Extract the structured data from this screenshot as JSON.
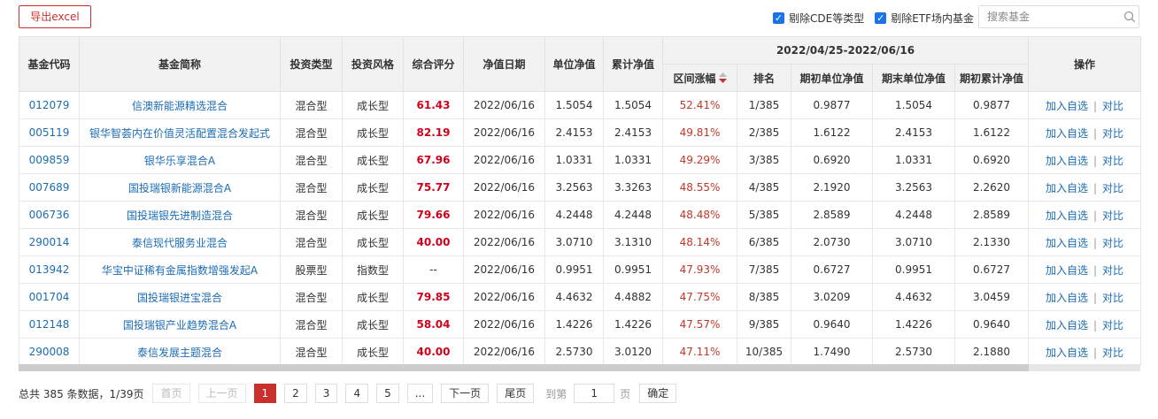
{
  "toolbar": {
    "export_label": "导出excel",
    "filter_cde": "剔除CDE等类型",
    "filter_etf": "剔除ETF场内基金",
    "search_placeholder": "搜索基金"
  },
  "table": {
    "headers": {
      "code": "基金代码",
      "name": "基金简称",
      "type": "投资类型",
      "style": "投资风格",
      "score": "综合评分",
      "nav_date": "净值日期",
      "unit_nav": "单位净值",
      "acc_nav": "累计净值",
      "period": "2022/04/25-2022/06/16",
      "change": "区间涨幅",
      "rank": "排名",
      "start_unit": "期初单位净值",
      "end_unit": "期末单位净值",
      "start_acc": "期初累计净值",
      "ops": "操作"
    },
    "rows": [
      {
        "code": "012079",
        "name": "信澳新能源精选混合",
        "type": "混合型",
        "style": "成长型",
        "score": "61.43",
        "date": "2022/06/16",
        "unit": "1.5054",
        "acc": "1.5054",
        "change": "52.41%",
        "rank": "1/385",
        "s_unit": "0.9877",
        "e_unit": "1.5054",
        "s_acc": "0.9877",
        "add": "加入自选",
        "cmp": "对比"
      },
      {
        "code": "005119",
        "name": "银华智荟内在价值灵活配置混合发起式",
        "type": "混合型",
        "style": "成长型",
        "score": "82.19",
        "date": "2022/06/16",
        "unit": "2.4153",
        "acc": "2.4153",
        "change": "49.81%",
        "rank": "2/385",
        "s_unit": "1.6122",
        "e_unit": "2.4153",
        "s_acc": "1.6122",
        "add": "加入自选",
        "cmp": "对比"
      },
      {
        "code": "009859",
        "name": "银华乐享混合A",
        "type": "混合型",
        "style": "成长型",
        "score": "67.96",
        "date": "2022/06/16",
        "unit": "1.0331",
        "acc": "1.0331",
        "change": "49.29%",
        "rank": "3/385",
        "s_unit": "0.6920",
        "e_unit": "1.0331",
        "s_acc": "0.6920",
        "add": "加入自选",
        "cmp": "对比"
      },
      {
        "code": "007689",
        "name": "国投瑞银新能源混合A",
        "type": "混合型",
        "style": "成长型",
        "score": "75.77",
        "date": "2022/06/16",
        "unit": "3.2563",
        "acc": "3.3263",
        "change": "48.55%",
        "rank": "4/385",
        "s_unit": "2.1920",
        "e_unit": "3.2563",
        "s_acc": "2.2620",
        "add": "加入自选",
        "cmp": "对比"
      },
      {
        "code": "006736",
        "name": "国投瑞银先进制造混合",
        "type": "混合型",
        "style": "成长型",
        "score": "79.66",
        "date": "2022/06/16",
        "unit": "4.2448",
        "acc": "4.2448",
        "change": "48.48%",
        "rank": "5/385",
        "s_unit": "2.8589",
        "e_unit": "4.2448",
        "s_acc": "2.8589",
        "add": "加入自选",
        "cmp": "对比"
      },
      {
        "code": "290014",
        "name": "泰信现代服务业混合",
        "type": "混合型",
        "style": "成长型",
        "score": "40.00",
        "date": "2022/06/16",
        "unit": "3.0710",
        "acc": "3.1310",
        "change": "48.14%",
        "rank": "6/385",
        "s_unit": "2.0730",
        "e_unit": "3.0710",
        "s_acc": "2.1330",
        "add": "加入自选",
        "cmp": "对比"
      },
      {
        "code": "013942",
        "name": "华宝中证稀有金属指数增强发起A",
        "type": "股票型",
        "style": "指数型",
        "score": "--",
        "date": "2022/06/16",
        "unit": "0.9951",
        "acc": "0.9951",
        "change": "47.93%",
        "rank": "7/385",
        "s_unit": "0.6727",
        "e_unit": "0.9951",
        "s_acc": "0.6727",
        "add": "加入自选",
        "cmp": "对比"
      },
      {
        "code": "001704",
        "name": "国投瑞银进宝混合",
        "type": "混合型",
        "style": "成长型",
        "score": "79.85",
        "date": "2022/06/16",
        "unit": "4.4632",
        "acc": "4.4882",
        "change": "47.75%",
        "rank": "8/385",
        "s_unit": "3.0209",
        "e_unit": "4.4632",
        "s_acc": "3.0459",
        "add": "加入自选",
        "cmp": "对比"
      },
      {
        "code": "012148",
        "name": "国投瑞银产业趋势混合A",
        "type": "混合型",
        "style": "成长型",
        "score": "58.04",
        "date": "2022/06/16",
        "unit": "1.4226",
        "acc": "1.4226",
        "change": "47.57%",
        "rank": "9/385",
        "s_unit": "0.9640",
        "e_unit": "1.4226",
        "s_acc": "0.9640",
        "add": "加入自选",
        "cmp": "对比"
      },
      {
        "code": "290008",
        "name": "泰信发展主题混合",
        "type": "混合型",
        "style": "成长型",
        "score": "40.00",
        "date": "2022/06/16",
        "unit": "2.5730",
        "acc": "3.0120",
        "change": "47.11%",
        "rank": "10/385",
        "s_unit": "1.7490",
        "e_unit": "2.5730",
        "s_acc": "2.1880",
        "add": "加入自选",
        "cmp": "对比"
      }
    ]
  },
  "pager": {
    "total_text": "总共 385 条数据，1/39页",
    "first": "首页",
    "prev": "上一页",
    "pages": [
      "1",
      "2",
      "3",
      "4",
      "5"
    ],
    "ellipsis": "...",
    "next": "下一页",
    "last": "尾页",
    "goto_label": "到第",
    "goto_value": "1",
    "page_unit": "页",
    "confirm": "确定"
  },
  "colors": {
    "accent_red": "#c9302c",
    "link_blue": "#1c6cb4",
    "checkbox_blue": "#1a73e8"
  }
}
